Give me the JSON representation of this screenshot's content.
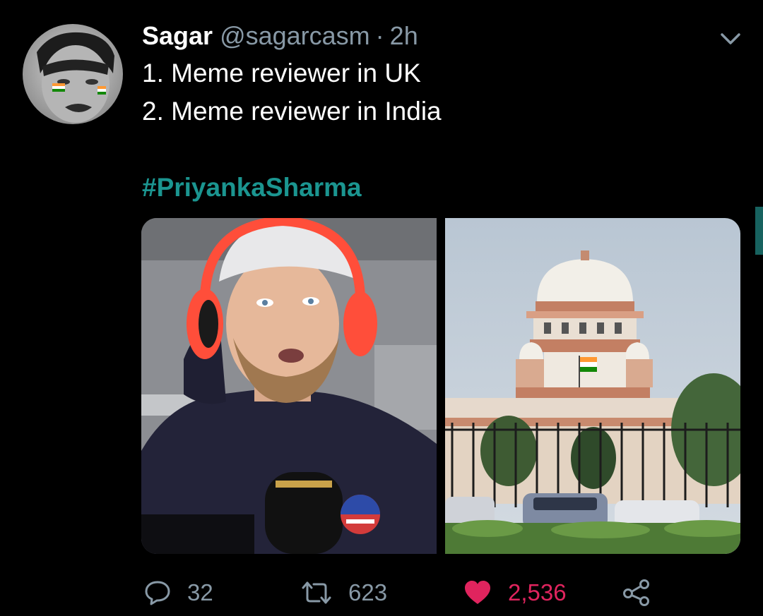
{
  "tweet": {
    "display_name": "Sagar",
    "handle": "@sagarcasm",
    "separator": "·",
    "time": "2h",
    "lines": [
      "1. Meme reviewer in UK",
      "2. Meme reviewer in India"
    ],
    "hashtag": "#PriyankaSharma"
  },
  "media": [
    {
      "name": "streamer-with-headphones-photo"
    },
    {
      "name": "supreme-court-building-photo"
    }
  ],
  "actions": {
    "replies": "32",
    "retweets": "623",
    "likes": "2,536",
    "liked": true
  },
  "icons": {
    "more": "chevron-down-icon",
    "reply": "reply-bubble-icon",
    "retweet": "retweet-arrows-icon",
    "like": "heart-icon",
    "share": "share-icon"
  },
  "colors": {
    "background": "#000000",
    "text": "#ffffff",
    "muted": "#8899a6",
    "hashtag": "#1b9590",
    "like": "#e0245e"
  }
}
